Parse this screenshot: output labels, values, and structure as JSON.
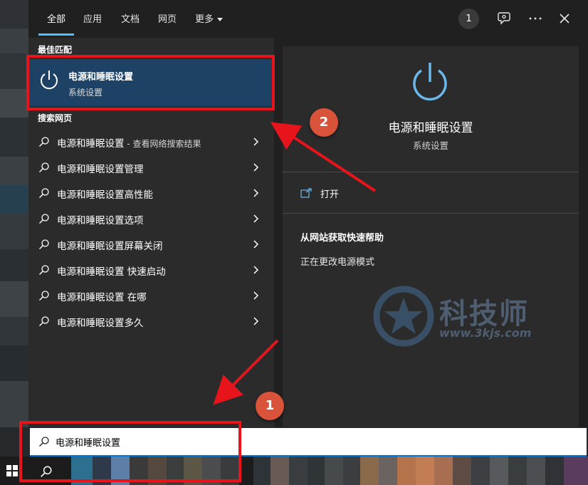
{
  "tabs": [
    {
      "label": "全部"
    },
    {
      "label": "应用"
    },
    {
      "label": "文档"
    },
    {
      "label": "网页"
    },
    {
      "label": "更多"
    }
  ],
  "badge_count": "1",
  "left": {
    "best_match_label": "最佳匹配",
    "best_match": {
      "title": "电源和睡眠设置",
      "subtitle": "系统设置"
    },
    "web_label": "搜索网页",
    "web_items": [
      {
        "label": "电源和睡眠设置",
        "suffix": " - 查看网络搜索结果"
      },
      {
        "label": "电源和睡眠设置管理",
        "suffix": ""
      },
      {
        "label": "电源和睡眠设置高性能",
        "suffix": ""
      },
      {
        "label": "电源和睡眠设置选项",
        "suffix": ""
      },
      {
        "label": "电源和睡眠设置屏幕关闭",
        "suffix": ""
      },
      {
        "label": "电源和睡眠设置 快速启动",
        "suffix": ""
      },
      {
        "label": "电源和睡眠设置 在哪",
        "suffix": ""
      },
      {
        "label": "电源和睡眠设置多久",
        "suffix": ""
      }
    ]
  },
  "right": {
    "title": "电源和睡眠设置",
    "subtitle": "系统设置",
    "open_label": "打开",
    "help_title": "从网站获取快速帮助",
    "help_link": "正在更改电源模式"
  },
  "watermark": {
    "text_cn": "科技师",
    "text_url": "www.3kjs.com"
  },
  "search": {
    "value": "电源和睡眠设置"
  },
  "annotations": {
    "step1": "1",
    "step2": "2"
  },
  "colors": {
    "accent": "#4cc2ff",
    "selection": "#1d4266",
    "highlight_red": "#e8141c",
    "step_circle": "#d9533a"
  }
}
